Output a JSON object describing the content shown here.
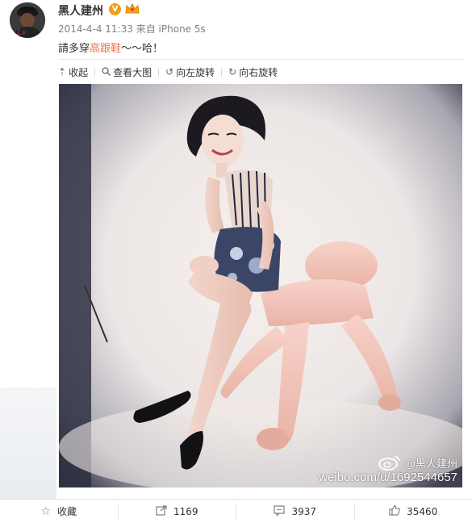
{
  "user": {
    "name": "黑人建州",
    "vip_badge": "V"
  },
  "meta": {
    "time": "2014-4-4 11:33",
    "from_prefix": "来自",
    "source": "iPhone 5s"
  },
  "post": {
    "text_before": "請多穿",
    "topic": "高跟鞋",
    "text_after": "～～哈！"
  },
  "toolbar": {
    "collapse": "收起",
    "view_large": "查看大图",
    "rotate_left": "向左旋转",
    "rotate_right": "向右旋转"
  },
  "watermark": {
    "user": "@黑人建州",
    "url": "weibo.com/u/1692544657"
  },
  "actions": {
    "favorite": "收藏",
    "repost": "1169",
    "comment": "3937",
    "like": "35460"
  },
  "icons": {
    "collapse": "collapse-up-icon",
    "view_large": "magnifier-icon",
    "rotate_left": "rotate-left-icon",
    "rotate_right": "rotate-right-icon",
    "favorite": "star-icon",
    "repost": "repost-icon",
    "comment": "comment-icon",
    "like": "thumbs-up-icon"
  },
  "colors": {
    "topic": "#eb7350",
    "vip": "#f39c12"
  }
}
